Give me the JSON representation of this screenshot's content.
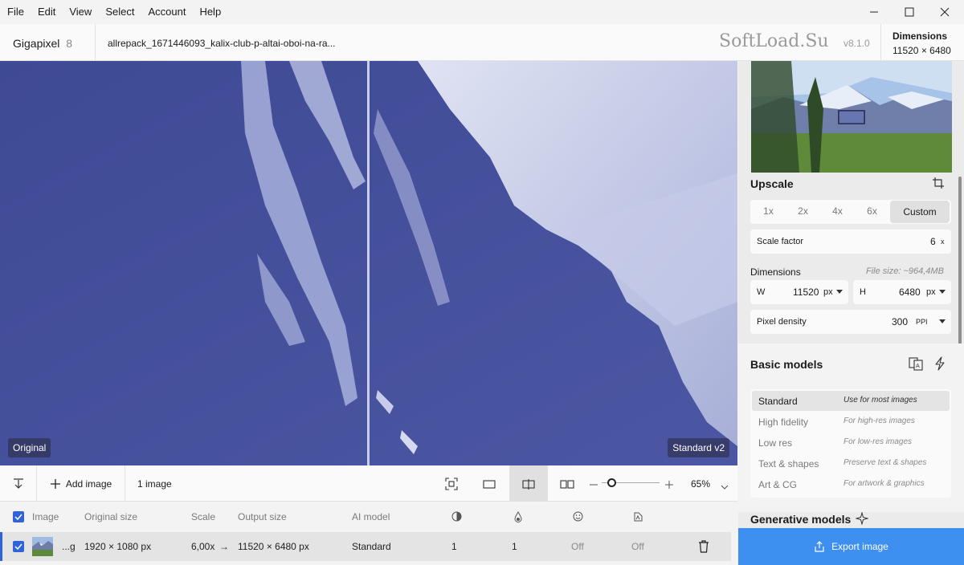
{
  "menu": [
    "File",
    "Edit",
    "View",
    "Select",
    "Account",
    "Help"
  ],
  "app": {
    "name": "Gigapixel",
    "version_major": "8",
    "filename": "allrepack_1671446093_kalix-club-p-altai-oboi-na-ra...",
    "watermark": "SoftLoad.Su",
    "version": "v8.1.0"
  },
  "header_dims": {
    "label": "Dimensions",
    "value": "11520 × 6480"
  },
  "canvas": {
    "left_label": "Original",
    "right_label": "Standard v2",
    "tint": "#4b559f"
  },
  "upscale": {
    "title": "Upscale",
    "scales": [
      "1x",
      "2x",
      "4x",
      "6x",
      "Custom"
    ],
    "selected": "Custom",
    "scale_factor_label": "Scale factor",
    "scale_factor_value": "6",
    "scale_factor_unit": "x",
    "dimensions_label": "Dimensions",
    "file_size": "File size: ~964,4MB",
    "w_label": "W",
    "w_value": "11520",
    "w_unit": "px",
    "h_label": "H",
    "h_value": "6480",
    "h_unit": "px",
    "density_label": "Pixel density",
    "density_value": "300",
    "density_unit": "PPI"
  },
  "basic_models": {
    "title": "Basic models",
    "items": [
      {
        "name": "Standard",
        "desc": "Use for most images"
      },
      {
        "name": "High fidelity",
        "desc": "For high-res images"
      },
      {
        "name": "Low res",
        "desc": "For low-res images"
      },
      {
        "name": "Text & shapes",
        "desc": "Preserve text & shapes"
      },
      {
        "name": "Art & CG",
        "desc": "For artwork & graphics"
      }
    ]
  },
  "generative_models": {
    "title": "Generative models"
  },
  "toolbar": {
    "add_image": "Add image",
    "count": "1 image",
    "zoom": "65%",
    "zoom_fraction": 0.18
  },
  "table": {
    "headers": {
      "image": "Image",
      "original": "Original size",
      "scale": "Scale",
      "output": "Output size",
      "model": "AI model"
    },
    "row": {
      "name": "...g",
      "original": "1920 × 1080 px",
      "scale": "6,00x",
      "arrow": "→",
      "output": "11520 × 6480 px",
      "model": "Standard",
      "c1": "1",
      "c2": "1",
      "c3": "Off",
      "c4": "Off"
    }
  },
  "export": {
    "label": "Export image"
  },
  "colors": {
    "accent": "#2e63d9",
    "export": "#3d8ff0"
  }
}
